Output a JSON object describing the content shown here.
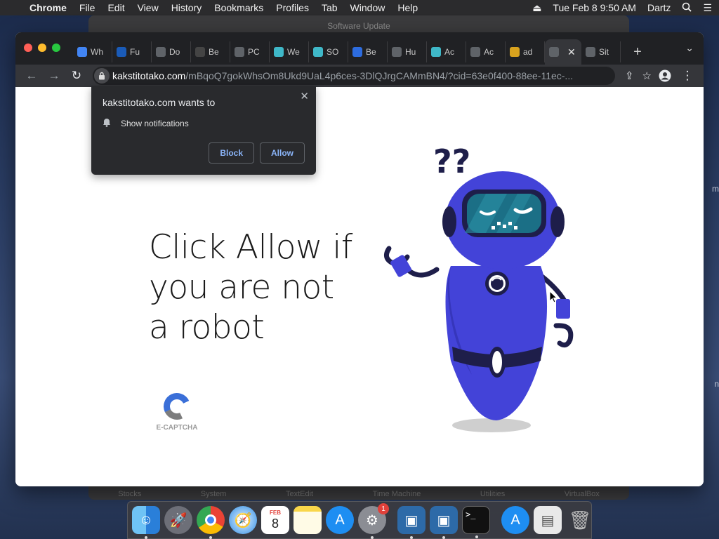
{
  "menubar": {
    "app": "Chrome",
    "items": [
      "File",
      "Edit",
      "View",
      "History",
      "Bookmarks",
      "Profiles",
      "Tab",
      "Window",
      "Help"
    ],
    "datetime": "Tue Feb 8  9:50 AM",
    "user": "Dartz"
  },
  "background_window": {
    "title": "Software Update",
    "dock_labels": [
      "Stocks",
      "System",
      "TextEdit",
      "Time Machine",
      "Utilities",
      "VirtualBox"
    ],
    "side_labels": [
      "m",
      "n"
    ]
  },
  "tabs": [
    {
      "label": "Wh",
      "icon": "chrome-icon",
      "color": "#4285f4"
    },
    {
      "label": "Fu",
      "icon": "vitw-icon",
      "color": "#1a5bb8"
    },
    {
      "label": "Do",
      "icon": "globe-icon",
      "color": "#5f6368"
    },
    {
      "label": "Be",
      "icon": "shield-lock-icon",
      "color": "#444"
    },
    {
      "label": "PC",
      "icon": "shield-icon",
      "color": "#5f6368"
    },
    {
      "label": "We",
      "icon": "s-icon",
      "color": "#3fb8c8"
    },
    {
      "label": "SO",
      "icon": "s-icon",
      "color": "#3fb8c8"
    },
    {
      "label": "Be",
      "icon": "bolt-icon",
      "color": "#2d6cdf"
    },
    {
      "label": "Hu",
      "icon": "globe-icon",
      "color": "#5f6368"
    },
    {
      "label": "Ac",
      "icon": "s-icon",
      "color": "#3fb8c8"
    },
    {
      "label": "Ac",
      "icon": "globe-icon",
      "color": "#5f6368"
    },
    {
      "label": "ad",
      "icon": "bee-icon",
      "color": "#d8a21e"
    },
    {
      "label": "",
      "icon": "globe-icon",
      "color": "#5f6368",
      "active": true
    },
    {
      "label": "Sit",
      "icon": "globe-icon",
      "color": "#5f6368"
    }
  ],
  "toolbar": {
    "url_host": "kakstitotako.com",
    "url_path": "/mBqoQ7gokWhsOm8Ukd9UaL4p6ces-3DlQJrgCAMmBN4/?cid=63e0f400-88ee-11ec-..."
  },
  "notification": {
    "title": "kakstitotako.com wants to",
    "permission": "Show notifications",
    "block_label": "Block",
    "allow_label": "Allow"
  },
  "page": {
    "headline": "Click Allow if you are not a robot",
    "captcha_label": "E-CAPTCHA"
  },
  "dock": {
    "apps": [
      "finder-icon",
      "launchpad-icon",
      "chrome-icon",
      "safari-icon",
      "calendar-icon",
      "notes-icon",
      "app-store-icon",
      "system-preferences-icon",
      "virtualbox-icon",
      "virtualbox-icon",
      "terminal-icon",
      "app-store-icon",
      "file-icon",
      "trash-icon"
    ],
    "calendar_month": "FEB",
    "calendar_day": "8",
    "badge_count": "1"
  }
}
